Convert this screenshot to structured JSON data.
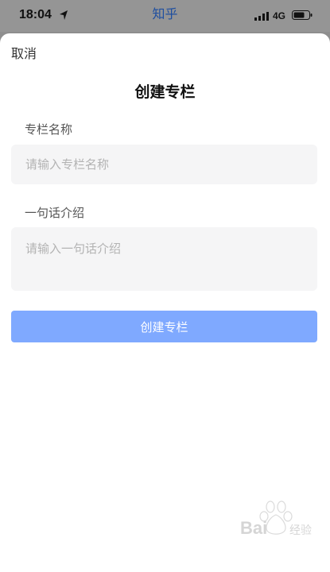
{
  "status_bar": {
    "time": "18:04",
    "app_name": "知乎",
    "network": "4G",
    "icons": [
      "location-arrow-icon",
      "signal-icon",
      "battery-icon"
    ]
  },
  "sheet": {
    "cancel_label": "取消",
    "title": "创建专栏",
    "name_field": {
      "label": "专栏名称",
      "placeholder": "请输入专栏名称",
      "value": ""
    },
    "intro_field": {
      "label": "一句话介绍",
      "placeholder": "请输入一句话介绍",
      "value": ""
    },
    "submit_label": "创建专栏"
  },
  "colors": {
    "button_disabled": "#7fa9ff",
    "input_background": "#f5f5f6",
    "app_name": "#1f4fa0"
  },
  "watermark": "Baidu 经验"
}
